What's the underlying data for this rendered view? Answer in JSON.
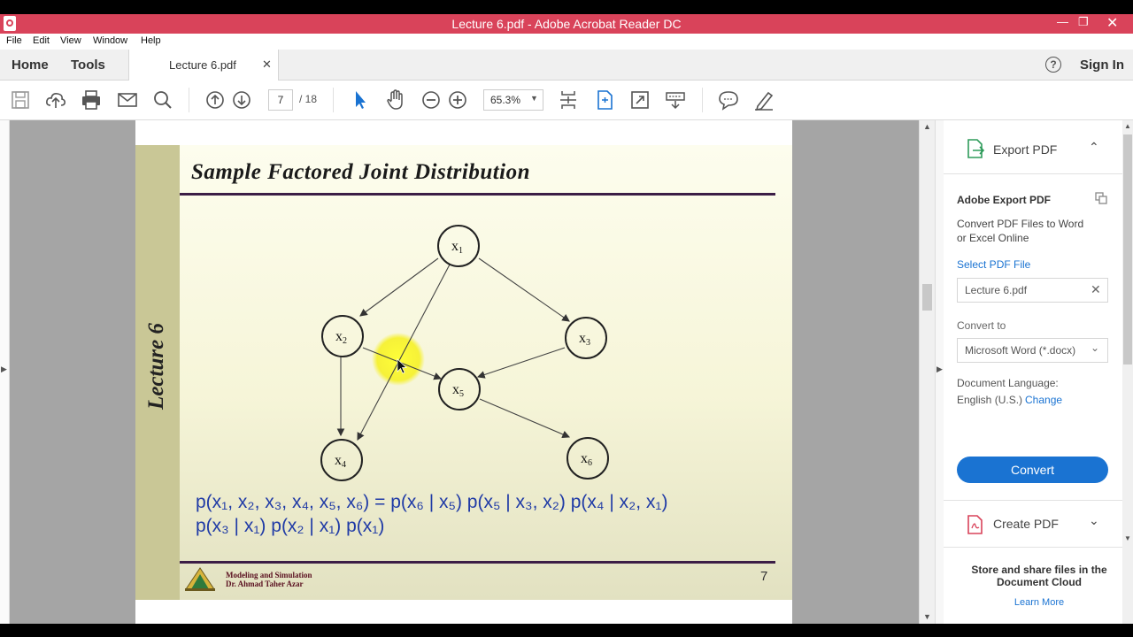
{
  "window": {
    "title": "Lecture 6.pdf - Adobe Acrobat Reader DC"
  },
  "menu": [
    "File",
    "Edit",
    "View",
    "Window",
    "Help"
  ],
  "tabs": {
    "home": "Home",
    "tools": "Tools",
    "document": "Lecture 6.pdf"
  },
  "header": {
    "sign_in": "Sign In"
  },
  "toolbar": {
    "page_current": "7",
    "page_total": "/ 18",
    "zoom": "65.3%"
  },
  "slide": {
    "title": "Sample Factored Joint Distribution",
    "side_label": "Lecture 6",
    "nodes": [
      {
        "base": "x",
        "sub": "1"
      },
      {
        "base": "x",
        "sub": "2"
      },
      {
        "base": "x",
        "sub": "3"
      },
      {
        "base": "x",
        "sub": "5"
      },
      {
        "base": "x",
        "sub": "4"
      },
      {
        "base": "x",
        "sub": "6"
      }
    ],
    "formula_line1": "p(x₁, x₂, x₃, x₄, x₅, x₆) = p(x₆ | x₅) p(x₅ | x₃, x₂) p(x₄ | x₂, x₁)",
    "formula_line2": "p(x₃ | x₁) p(x₂ | x₁) p(x₁)",
    "footer_line1": "Modeling and Simulation",
    "footer_line2": "Dr. Ahmad Taher Azar",
    "page_number": "7"
  },
  "panel": {
    "export_pdf": "Export PDF",
    "adobe_export_pdf": "Adobe Export PDF",
    "description_line1": "Convert PDF Files to Word",
    "description_line2": "or Excel Online",
    "select_pdf_file": "Select PDF File",
    "file_name": "Lecture 6.pdf",
    "convert_to": "Convert to",
    "format": "Microsoft Word (*.docx)",
    "document_language": "Document Language:",
    "language": "English (U.S.)",
    "change": "Change",
    "convert_button": "Convert",
    "create_pdf": "Create PDF",
    "store_line1": "Store and share files in the",
    "store_line2": "Document Cloud",
    "learn_more": "Learn More"
  },
  "colors": {
    "title_bar": "#d9435a",
    "accent_blue": "#1a73d2",
    "slide_side": "#c9c796",
    "formula_blue": "#1f3aa6"
  }
}
